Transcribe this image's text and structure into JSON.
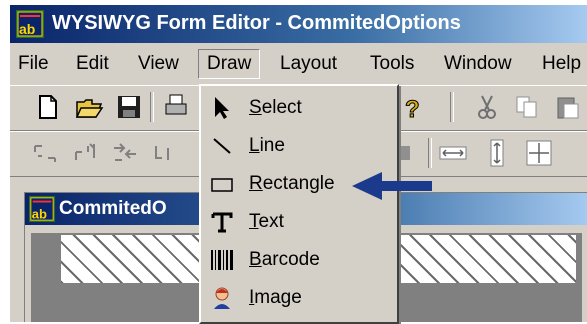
{
  "window": {
    "title": "WYSIWYG Form Editor - CommitedOptions",
    "icon": "app-logo-icon"
  },
  "menubar": {
    "items": [
      {
        "label": "File"
      },
      {
        "label": "Edit"
      },
      {
        "label": "View"
      },
      {
        "label": "Draw"
      },
      {
        "label": "Layout"
      },
      {
        "label": "Tools"
      },
      {
        "label": "Window"
      },
      {
        "label": "Help"
      }
    ]
  },
  "draw_menu": {
    "items": [
      {
        "mnemonic": "S",
        "rest": "elect",
        "icon": "arrow-pointer-icon"
      },
      {
        "mnemonic": "L",
        "rest": "ine",
        "icon": "line-icon"
      },
      {
        "mnemonic": "R",
        "rest": "ectangle",
        "icon": "rectangle-icon"
      },
      {
        "mnemonic": "T",
        "rest": "ext",
        "icon": "text-icon"
      },
      {
        "mnemonic": "B",
        "rest": "arcode",
        "icon": "barcode-icon"
      },
      {
        "mnemonic": "I",
        "rest": "mage",
        "icon": "image-icon"
      }
    ]
  },
  "child_window": {
    "title": "CommitedO"
  },
  "colors": {
    "titlebar_start": "#0a246a",
    "titlebar_end": "#a6caf0",
    "face": "#d4d0c8",
    "annotation_arrow": "#1c3a8c"
  }
}
